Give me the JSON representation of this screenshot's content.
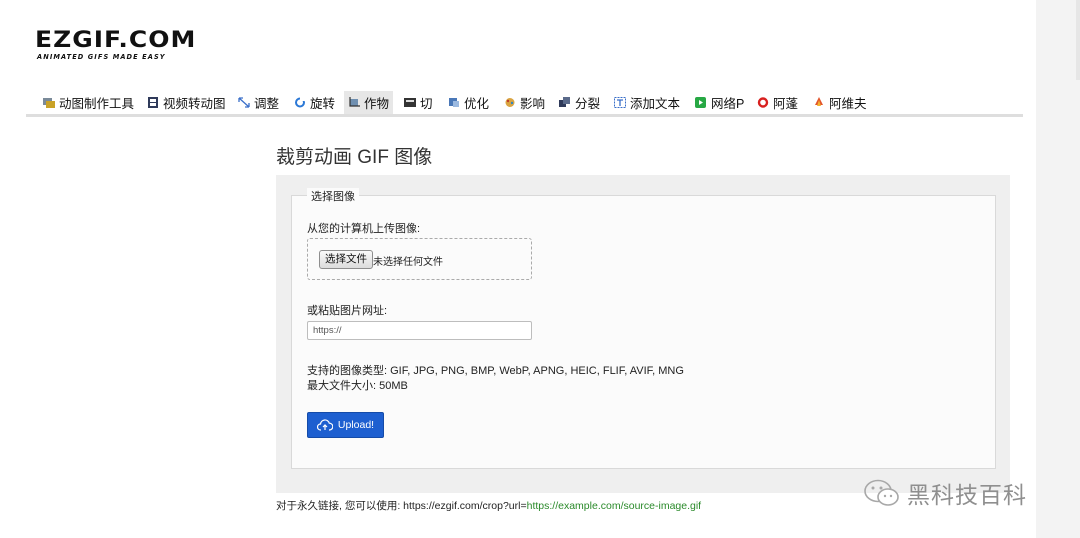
{
  "logo": {
    "main": "EZGIF.COM",
    "tagline": "ANIMATED GIFS MADE EASY"
  },
  "nav": {
    "items": [
      {
        "label": "动图制作工具",
        "icon": "gif-maker-icon",
        "active": false
      },
      {
        "label": "视频转动图",
        "icon": "video-icon",
        "active": false
      },
      {
        "label": "调整",
        "icon": "resize-icon",
        "active": false
      },
      {
        "label": "旋转",
        "icon": "rotate-icon",
        "active": false
      },
      {
        "label": "作物",
        "icon": "crop-icon",
        "active": true
      },
      {
        "label": "切",
        "icon": "cut-icon",
        "active": false
      },
      {
        "label": "优化",
        "icon": "optimize-icon",
        "active": false
      },
      {
        "label": "影响",
        "icon": "effects-icon",
        "active": false
      },
      {
        "label": "分裂",
        "icon": "split-icon",
        "active": false
      },
      {
        "label": "添加文本",
        "icon": "text-icon",
        "active": false
      },
      {
        "label": "网络P",
        "icon": "webp-icon",
        "active": false
      },
      {
        "label": "阿蓬",
        "icon": "apng-icon",
        "active": false
      },
      {
        "label": "阿维夫",
        "icon": "avif-icon",
        "active": false
      }
    ],
    "colors": {
      "active_bg": "#e7e7e7"
    }
  },
  "main": {
    "title": "裁剪动画 GIF 图像",
    "form": {
      "legend": "选择图像",
      "upload_label": "从您的计算机上传图像:",
      "file_button": "选择文件",
      "file_status": "未选择任何文件",
      "url_label": "或粘贴图片网址:",
      "url_placeholder": "https://",
      "url_value": "",
      "supported_types": "支持的图像类型: GIF, JPG, PNG, BMP, WebP, APNG, HEIC, FLIF, AVIF, MNG",
      "max_size": "最大文件大小: 50MB",
      "upload_button": "Upload!",
      "upload_icon": "cloud-upload-icon",
      "upload_color": "#1d5fd0"
    }
  },
  "footer": {
    "permalink_prefix": "对于永久链接, 您可以使用: https://ezgif.com/crop?url=",
    "permalink_link": "https://example.com/source-image.gif",
    "link_color": "#2a8a2a"
  },
  "watermark": {
    "text": "黑科技百科",
    "icon": "wechat-icon"
  }
}
